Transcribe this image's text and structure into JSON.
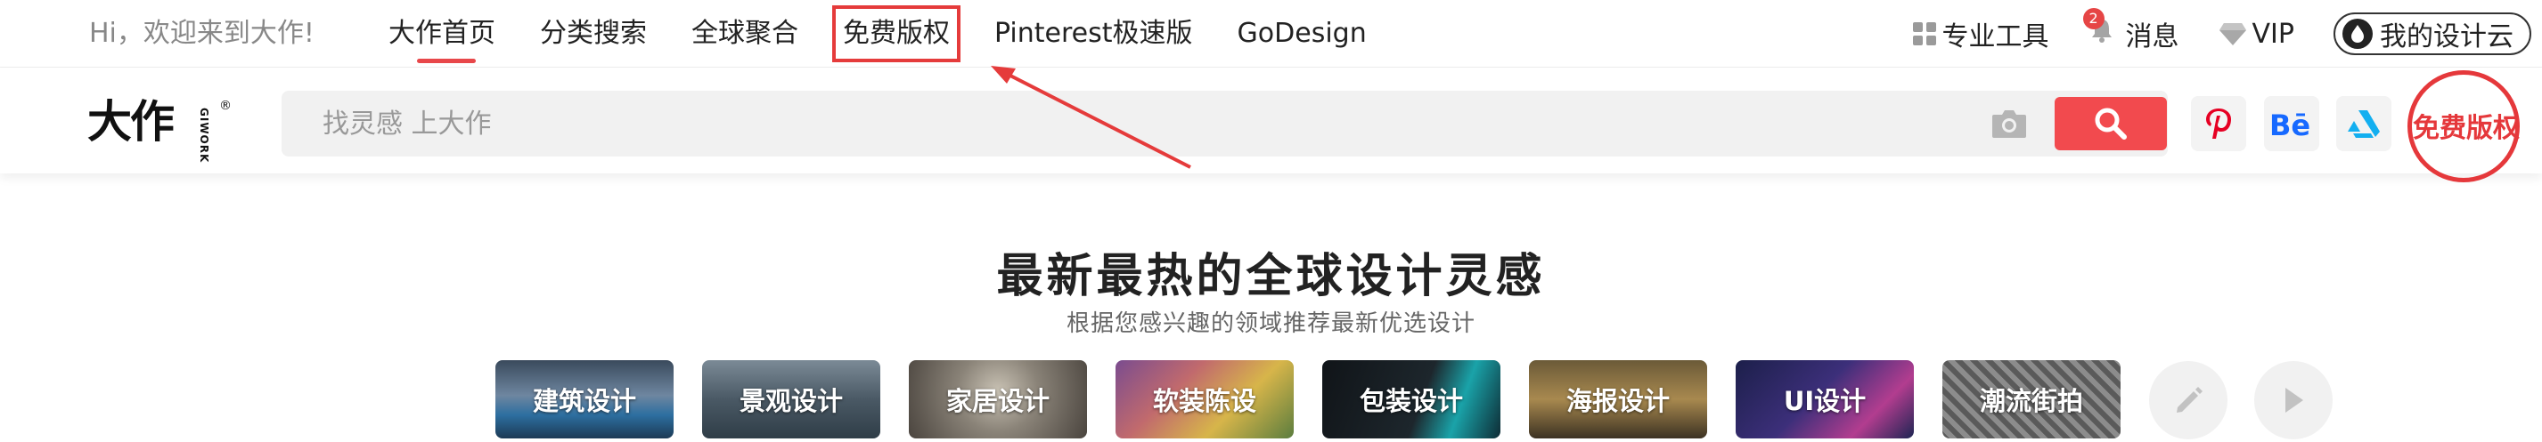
{
  "topbar": {
    "greeting": "Hi，欢迎来到大作!",
    "nav": [
      {
        "label": "大作首页",
        "active": true
      },
      {
        "label": "分类搜索"
      },
      {
        "label": "全球聚合"
      },
      {
        "label": "免费版权",
        "highlighted": true
      },
      {
        "label": "Pinterest极速版"
      },
      {
        "label": "GoDesign"
      }
    ],
    "tools_label": "专业工具",
    "messages_label": "消息",
    "messages_badge": "2",
    "vip_label": "VIP",
    "cloud_label": "我的设计云"
  },
  "header": {
    "logo_text": "大作",
    "logo_sub": "GIWORK",
    "logo_reg": "®",
    "search_placeholder": "找灵感 上大作",
    "free_copyright_label": "免费版权",
    "social_icons": [
      "pinterest-icon",
      "behance-icon",
      "artstation-icon"
    ]
  },
  "hero": {
    "title": "最新最热的全球设计灵感",
    "subtitle": "根据您感兴趣的领域推荐最新优选设计"
  },
  "categories": [
    {
      "label": "建筑设计"
    },
    {
      "label": "景观设计"
    },
    {
      "label": "家居设计"
    },
    {
      "label": "软装陈设"
    },
    {
      "label": "包装设计"
    },
    {
      "label": "海报设计"
    },
    {
      "label": "UI设计"
    },
    {
      "label": "潮流街拍"
    }
  ],
  "colors": {
    "accent": "#e8474a",
    "annotation": "#e53b3b",
    "search_button": "#f24a4e",
    "pinterest": "#e60023",
    "behance": "#1769ff",
    "artstation": "#13aff0"
  }
}
